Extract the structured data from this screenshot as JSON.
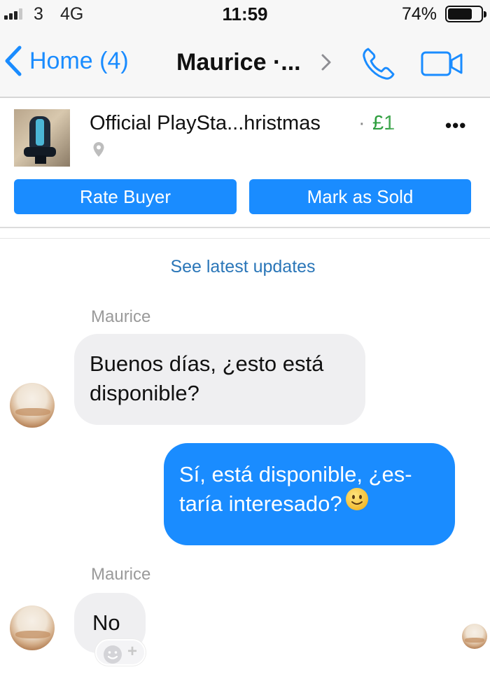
{
  "status_bar": {
    "carrier": "3",
    "network": "4G",
    "time": "11:59",
    "battery_percent": "74%",
    "battery_level": 0.74,
    "signal_bars_filled": 3,
    "signal_bars_total": 4
  },
  "nav": {
    "back_label": "Home (4)",
    "title": "Maurice ·...",
    "icons": [
      "chevron-left-icon",
      "chevron-right-icon",
      "phone-icon",
      "video-camera-icon"
    ]
  },
  "listing": {
    "title": "Official PlaySta...hristmas",
    "separator": "·",
    "price": "£1",
    "more_label": "•••",
    "rate_buyer_label": "Rate Buyer",
    "mark_sold_label": "Mark as Sold"
  },
  "chat": {
    "see_latest_updates": "See latest updates",
    "messages": [
      {
        "sender": "Maurice",
        "text_line1": "Buenos días, ¿esto está",
        "text_line2": "disponible?"
      },
      {
        "sender": "me",
        "text_line1": "Sí, está disponible, ¿es-",
        "text_line2": "taría interesado?",
        "emoji": "slightly-smiling-face-icon"
      },
      {
        "sender": "Maurice",
        "text": "No"
      }
    ],
    "react_plus": "+"
  },
  "colors": {
    "accent": "#1a8cff",
    "price_green": "#2e9e3e",
    "incoming_bubble": "#efeff1",
    "link_blue": "#2a76b8"
  }
}
